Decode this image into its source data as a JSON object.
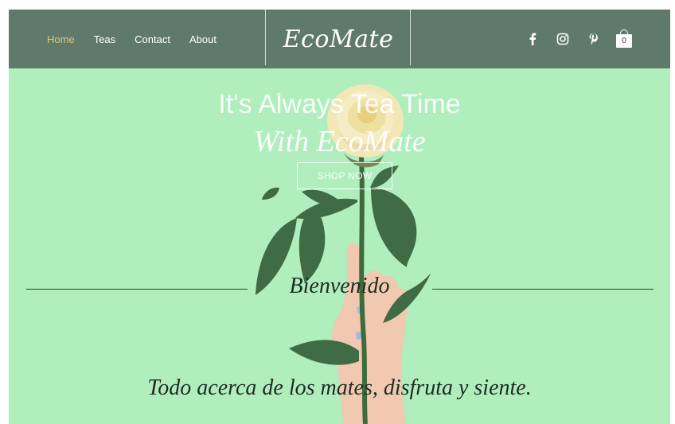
{
  "header": {
    "nav": [
      {
        "label": "Home",
        "active": true
      },
      {
        "label": "Teas",
        "active": false
      },
      {
        "label": "Contact",
        "active": false
      },
      {
        "label": "About",
        "active": false
      }
    ],
    "logo": "EcoMate",
    "social_icons": [
      "facebook-icon",
      "instagram-icon",
      "pinterest-icon"
    ],
    "cart_count": "0"
  },
  "hero": {
    "title": "It's Always Tea Time",
    "subtitle": "With EcoMate",
    "button_label": "SHOP NOW",
    "welcome": "Bienvenido",
    "tagline": "Todo acerca de los mates, disfruta y siente."
  },
  "colors": {
    "header_bg": "#5f7a6a",
    "hero_bg": "#b0eebd",
    "active_nav": "#e8c27a"
  }
}
